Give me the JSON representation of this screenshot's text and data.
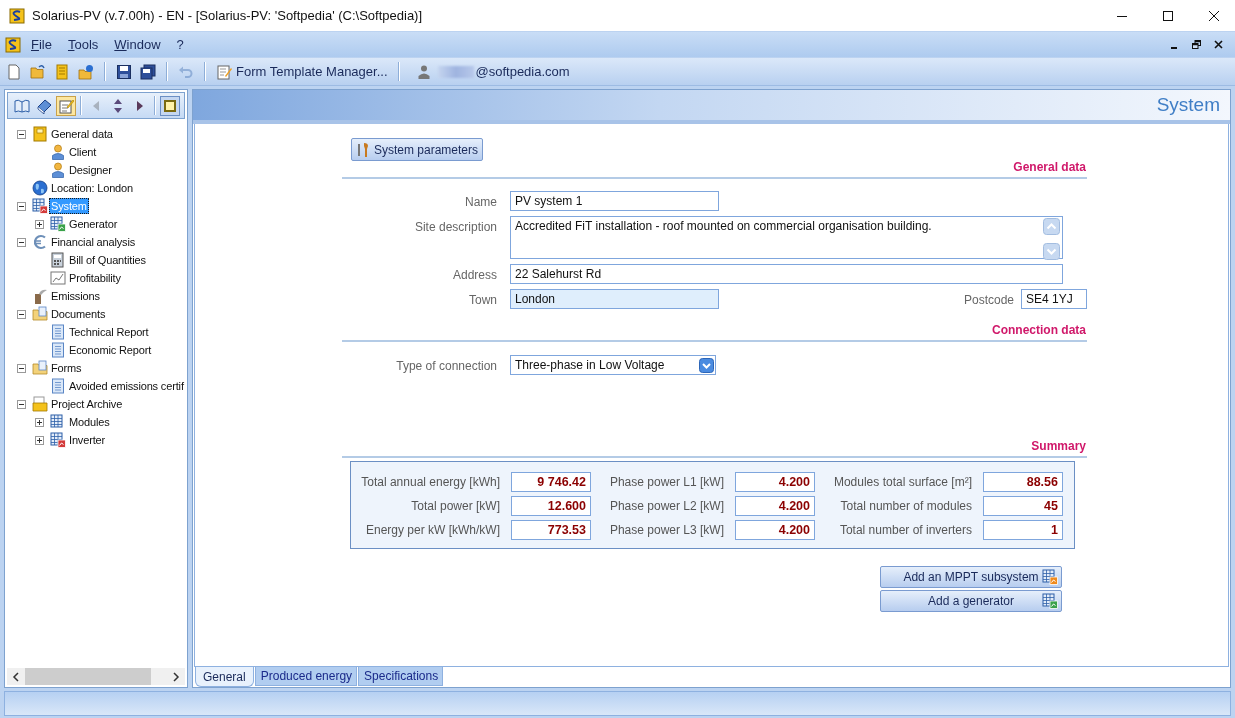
{
  "window": {
    "title": "Solarius-PV (v.7.00h) - EN - [Solarius-PV: 'Softpedia' (C:\\Softpedia)]"
  },
  "menu": [
    {
      "label": "File"
    },
    {
      "label": "Tools"
    },
    {
      "label": "Window"
    },
    {
      "label": "?"
    }
  ],
  "toolbar": {
    "buttons": [
      {
        "kind": "new",
        "disabled": false
      },
      {
        "kind": "open",
        "disabled": false
      },
      {
        "kind": "notes",
        "disabled": false
      },
      {
        "kind": "open-web",
        "disabled": false
      },
      {
        "kind": "sep"
      },
      {
        "kind": "save",
        "disabled": false
      },
      {
        "kind": "save-all",
        "disabled": false
      },
      {
        "kind": "sep"
      },
      {
        "kind": "undo",
        "disabled": true
      },
      {
        "kind": "sep"
      }
    ],
    "template_manager": "Form Template Manager...",
    "user": "@softpedia.com"
  },
  "sidebar": {
    "tools": [
      {
        "kind": "book-open",
        "selected": false
      },
      {
        "kind": "book",
        "selected": false
      },
      {
        "kind": "notepad",
        "selected": true
      },
      {
        "kind": "prev",
        "disabled": true
      },
      {
        "kind": "updown",
        "disabled": false
      },
      {
        "kind": "next",
        "disabled": false
      },
      {
        "kind": "frame",
        "disabled": false
      }
    ],
    "tree": [
      {
        "label": "General data",
        "kind": "notebook",
        "selected": false,
        "expanded": true,
        "children": [
          {
            "label": "Client",
            "kind": "person",
            "selected": false
          },
          {
            "label": "Designer",
            "kind": "person",
            "selected": false
          }
        ]
      },
      {
        "label": "Location: London",
        "kind": "globe",
        "selected": false
      },
      {
        "label": "System",
        "kind": "grid-red",
        "selected": true,
        "expanded": true,
        "children": [
          {
            "label": "Generator",
            "kind": "grid-green",
            "selected": false,
            "expanded": false
          }
        ]
      },
      {
        "label": "Financial analysis",
        "kind": "euro",
        "selected": false,
        "expanded": true,
        "children": [
          {
            "label": "Bill of Quantities",
            "kind": "calculator",
            "selected": false
          },
          {
            "label": "Profitability",
            "kind": "chart",
            "selected": false
          }
        ]
      },
      {
        "label": "Emissions",
        "kind": "chimney",
        "selected": false
      },
      {
        "label": "Documents",
        "kind": "folder",
        "selected": false,
        "expanded": true,
        "children": [
          {
            "label": "Technical Report",
            "kind": "document",
            "selected": false
          },
          {
            "label": "Economic Report",
            "kind": "document",
            "selected": false
          }
        ]
      },
      {
        "label": "Forms",
        "kind": "folder",
        "selected": false,
        "expanded": true,
        "children": [
          {
            "label": "Avoided emissions certif",
            "kind": "document",
            "selected": false
          }
        ]
      },
      {
        "label": "Project Archive",
        "kind": "archive",
        "selected": false,
        "expanded": true,
        "children": [
          {
            "label": "Modules",
            "kind": "grid",
            "selected": false,
            "expanded": false
          },
          {
            "label": "Inverter",
            "kind": "grid-red",
            "selected": false,
            "expanded": false
          }
        ]
      }
    ]
  },
  "page": {
    "title": "System",
    "parameters_button": "System parameters",
    "general_data": {
      "title": "General data",
      "name": {
        "label": "Name",
        "value": "PV system 1",
        "readonly": false
      },
      "site_description": {
        "label": "Site description",
        "value": "Accredited FiT installation - roof mounted on commercial organisation building.",
        "readonly": false
      },
      "address": {
        "label": "Address",
        "value": "22 Salehurst Rd",
        "readonly": false
      },
      "town": {
        "label": "Town",
        "value": "London",
        "readonly": true
      },
      "postcode": {
        "label": "Postcode",
        "value": "SE4 1YJ",
        "readonly": false
      }
    },
    "connection_data": {
      "title": "Connection data",
      "type_of_connection": {
        "label": "Type of connection",
        "value": "Three-phase in Low Voltage"
      }
    },
    "summary": {
      "title": "Summary",
      "items": [
        {
          "label": "Total annual energy [kWh]",
          "value": "9 746.42"
        },
        {
          "label": "Phase power L1 [kW]",
          "value": "4.200"
        },
        {
          "label": "Modules total surface [m²]",
          "value": "88.56"
        },
        {
          "label": "Total power [kW]",
          "value": "12.600"
        },
        {
          "label": "Phase power L2 [kW]",
          "value": "4.200"
        },
        {
          "label": "Total number of modules",
          "value": "45"
        },
        {
          "label": "Energy per kW [kWh/kW]",
          "value": "773.53"
        },
        {
          "label": "Phase power L3 [kW]",
          "value": "4.200"
        },
        {
          "label": "Total number of inverters",
          "value": "1"
        }
      ]
    },
    "actions": [
      {
        "label": "Add an MPPT subsystem",
        "kind": "grid-orange"
      },
      {
        "label": "Add a generator",
        "kind": "grid-green"
      }
    ]
  },
  "tabs": [
    {
      "label": "General",
      "selected": true
    },
    {
      "label": "Produced energy",
      "selected": false
    },
    {
      "label": "Specifications",
      "selected": false
    }
  ]
}
